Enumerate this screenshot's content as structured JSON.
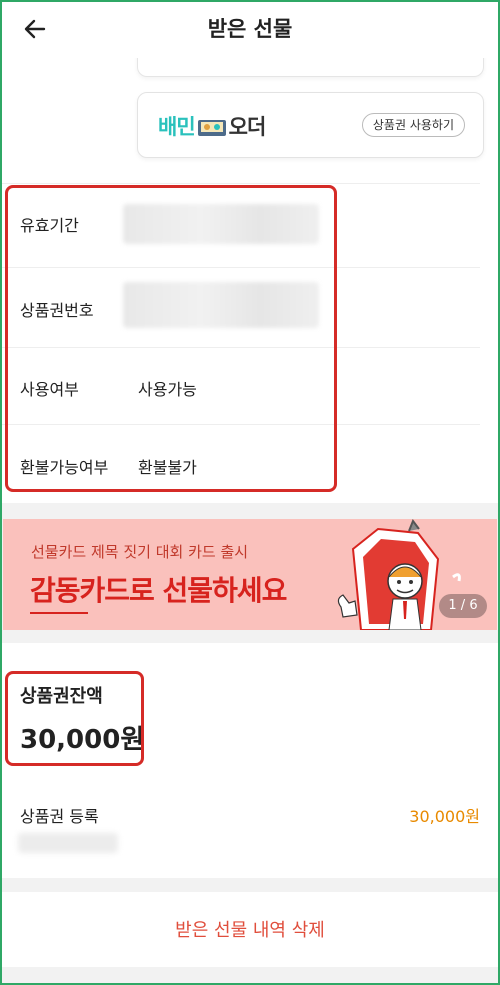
{
  "header": {
    "back_icon": "back-arrow-icon",
    "title": "받은 선물"
  },
  "brand_card": {
    "logo_part1": "배민",
    "logo_part2": "오더",
    "use_button": "상품권 사용하기"
  },
  "info": {
    "rows": [
      {
        "label": "유효기간",
        "value": ""
      },
      {
        "label": "상품권번호",
        "value": ""
      },
      {
        "label": "사용여부",
        "value": "사용가능"
      },
      {
        "label": "환불가능여부",
        "value": "환불불가"
      }
    ]
  },
  "banner": {
    "subtitle": "선물카드 제목 짓기 대회 카드 출시",
    "title": "감동카드로 선물하세요",
    "pager": "1 / 6"
  },
  "balance": {
    "label": "상품권잔액",
    "value": "30,000원"
  },
  "registration": {
    "label": "상품권 등록",
    "amount": "30,000원"
  },
  "actions": {
    "delete": "받은 선물 내역 삭제"
  },
  "colors": {
    "accent_red": "#d7231e",
    "baemin_mint": "#2ac1bc",
    "amount_orange": "#e88a00",
    "banner_bg": "#fac1bc"
  }
}
